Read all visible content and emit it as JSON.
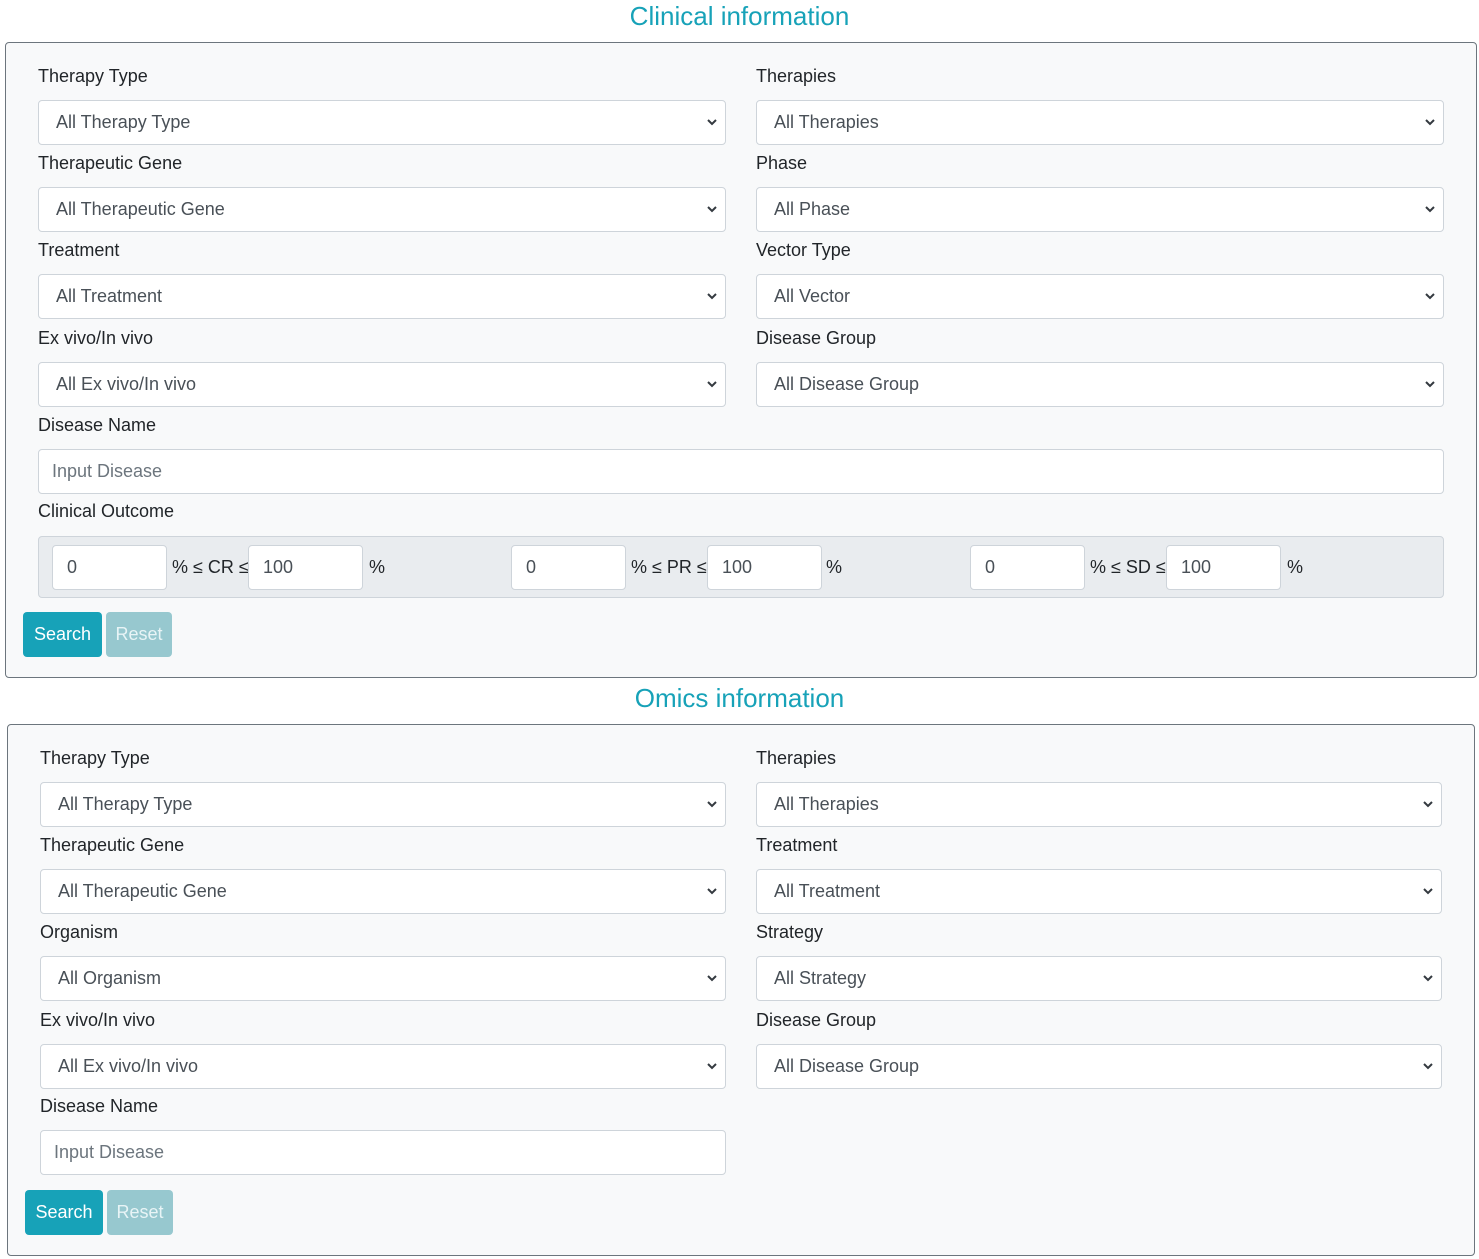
{
  "clinical": {
    "title": "Clinical information",
    "therapy_type": {
      "label": "Therapy Type",
      "value": "All Therapy Type"
    },
    "therapies": {
      "label": "Therapies",
      "value": "All Therapies"
    },
    "therapeutic_gene": {
      "label": "Therapeutic Gene",
      "value": "All Therapeutic Gene"
    },
    "phase": {
      "label": "Phase",
      "value": "All Phase"
    },
    "treatment": {
      "label": "Treatment",
      "value": "All Treatment"
    },
    "vector_type": {
      "label": "Vector Type",
      "value": "All Vector"
    },
    "ex_vivo": {
      "label": "Ex vivo/In vivo",
      "value": "All Ex vivo/In vivo"
    },
    "disease_group": {
      "label": "Disease Group",
      "value": "All Disease Group"
    },
    "disease_name": {
      "label": "Disease Name",
      "placeholder": "Input Disease"
    },
    "outcome": {
      "label": "Clinical Outcome",
      "cr": {
        "min": "0",
        "op": "% ≤ CR ≤",
        "max": "100",
        "unit": "%"
      },
      "pr": {
        "min": "0",
        "op": "% ≤ PR ≤",
        "max": "100",
        "unit": "%"
      },
      "sd": {
        "min": "0",
        "op": "% ≤ SD ≤",
        "max": "100",
        "unit": "%"
      }
    },
    "search_label": "Search",
    "reset_label": "Reset"
  },
  "omics": {
    "title": "Omics information",
    "therapy_type": {
      "label": "Therapy Type",
      "value": "All Therapy Type"
    },
    "therapies": {
      "label": "Therapies",
      "value": "All Therapies"
    },
    "therapeutic_gene": {
      "label": "Therapeutic Gene",
      "value": "All Therapeutic Gene"
    },
    "treatment": {
      "label": "Treatment",
      "value": "All Treatment"
    },
    "organism": {
      "label": "Organism",
      "value": "All Organism"
    },
    "strategy": {
      "label": "Strategy",
      "value": "All Strategy"
    },
    "ex_vivo": {
      "label": "Ex vivo/In vivo",
      "value": "All Ex vivo/In vivo"
    },
    "disease_group": {
      "label": "Disease Group",
      "value": "All Disease Group"
    },
    "disease_name": {
      "label": "Disease Name",
      "placeholder": "Input Disease"
    },
    "search_label": "Search",
    "reset_label": "Reset"
  },
  "colors": {
    "accent": "#17a2b8",
    "reset": "#97c8cf",
    "panel_bg": "#f8f9fa"
  },
  "icons": {
    "select_arrow": "chevron-down-icon"
  }
}
